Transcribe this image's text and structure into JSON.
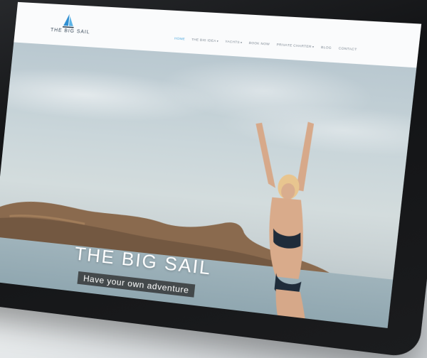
{
  "site": {
    "logo_text": "THE BIG SAIL",
    "nav": [
      {
        "label": "HOME",
        "active": true,
        "caret": false
      },
      {
        "label": "THE BIG IDEA",
        "active": false,
        "caret": true
      },
      {
        "label": "YACHTS",
        "active": false,
        "caret": true
      },
      {
        "label": "BOOK NOW",
        "active": false,
        "caret": false
      },
      {
        "label": "PRIVATE CHARTER",
        "active": false,
        "caret": true
      },
      {
        "label": "BLOG",
        "active": false,
        "caret": false
      },
      {
        "label": "CONTACT",
        "active": false,
        "caret": false
      }
    ]
  },
  "hero": {
    "title": "THE BIG SAIL",
    "tagline": "Have your own adventure",
    "prev_icon": "chevron-left-icon"
  },
  "colors": {
    "accent": "#4aa7dd",
    "bezel": "#141517"
  }
}
